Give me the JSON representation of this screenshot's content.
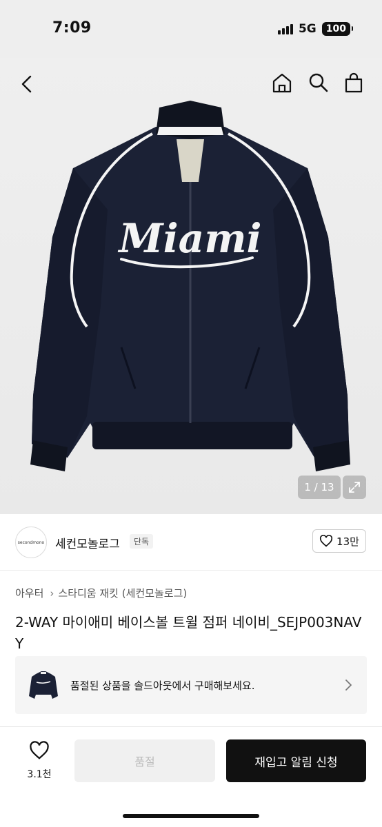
{
  "status": {
    "time": "7:09",
    "network": "5G",
    "battery": "100"
  },
  "gallery": {
    "counter": "1 / 13",
    "image_text": "Miami"
  },
  "brand": {
    "logo_text": "secondmono",
    "name": "세컨모놀로그",
    "badge": "단독",
    "likes": "13만"
  },
  "breadcrumb": [
    "아우터",
    "스타디움 재킷 (세컨모놀로그)"
  ],
  "product": {
    "title": "2-WAY 마이애미 베이스볼 트윌 점퍼 네이비_SEJP003NAVY"
  },
  "soldout_banner": {
    "text": "품절된 상품을 솔드아웃에서 구매해보세요."
  },
  "bottom_bar": {
    "wish_count": "3.1천",
    "soldout_label": "품절",
    "restock_label": "재입고 알림 신청"
  },
  "colors": {
    "accent": "#111111",
    "jacket": "#1c2236"
  }
}
